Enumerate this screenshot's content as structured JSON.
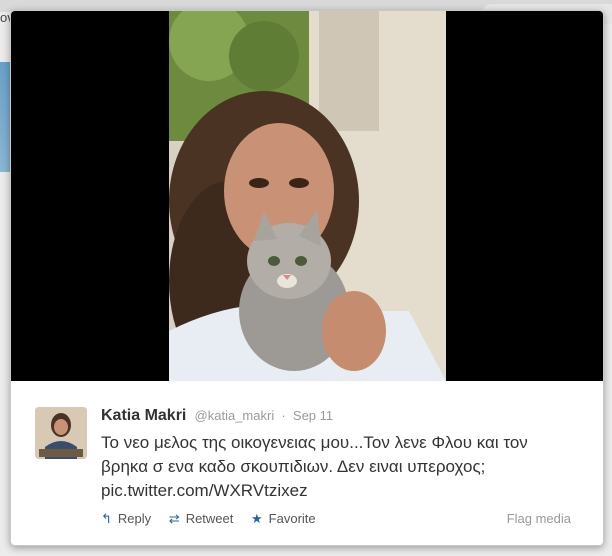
{
  "background": {
    "left_fragment": "ov"
  },
  "tweet": {
    "author_name": "Katia Makri",
    "author_handle": "@katia_makri",
    "separator": "·",
    "timestamp": "Sep 11",
    "text_lines": [
      "Το νεο μελος της οικογενειας μου...Τον λενε Φλου και τον",
      "βρηκα σ ενα καδο σκουπιδιων. Δεν ειναι υπεροχος;",
      "pic.twitter.com/WXRVtzixez"
    ],
    "actions": {
      "reply": "Reply",
      "retweet": "Retweet",
      "favorite": "Favorite"
    },
    "flag": "Flag media"
  },
  "icons": {
    "reply": "reply-icon",
    "retweet": "retweet-icon",
    "favorite": "star-icon"
  },
  "colors": {
    "accent": "#2a6496",
    "muted": "#999999",
    "text": "#333333"
  }
}
